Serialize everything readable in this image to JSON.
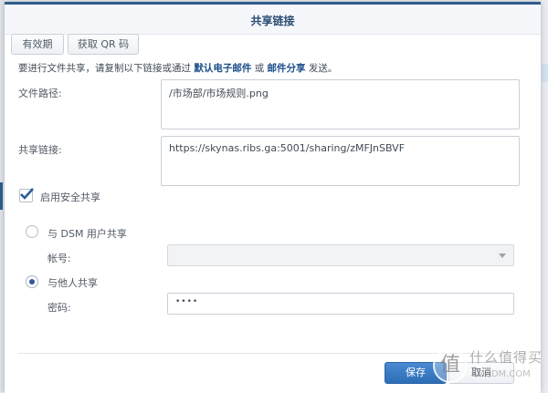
{
  "dialog": {
    "title": "共享链接"
  },
  "toolbar": {
    "validity_label": "有效期",
    "qr_label": "获取 QR 码"
  },
  "info": {
    "prefix": "要进行文件共享，请复制以下链接或通过",
    "link1": "默认电子邮件",
    "mid": "或",
    "link2": "邮件分享",
    "suffix": "发送。"
  },
  "form": {
    "path_label": "文件路径:",
    "path_value": "/市场部/市场规则.png",
    "link_label": "共享链接:",
    "link_value": "https://skynas.ribs.ga:5001/sharing/zMFJnSBVF",
    "secure_label": "启用安全共享",
    "secure_checked": true,
    "dsm_option": "与 DSM 用户共享",
    "account_label": "帐号:",
    "account_value": "",
    "others_option": "与他人共享",
    "password_label": "密码:",
    "password_value": "••••",
    "selected_option": "others"
  },
  "footer": {
    "save_label": "保存",
    "cancel_label": "取消"
  },
  "watermark": {
    "glyph": "值",
    "brand": "什么值得买",
    "site": "SMZDM.COM"
  }
}
